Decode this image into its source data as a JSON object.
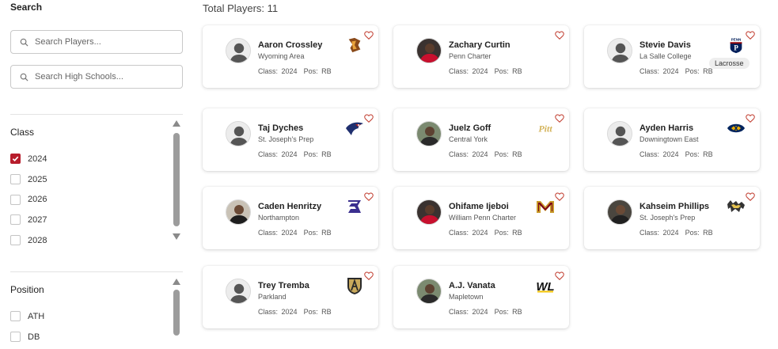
{
  "sidebar": {
    "search_heading": "Search",
    "player_search": {
      "placeholder": "Search Players..."
    },
    "school_search": {
      "placeholder": "Search High Schools..."
    },
    "class_filter": {
      "title": "Class",
      "options": [
        {
          "label": "2024",
          "checked": true
        },
        {
          "label": "2025",
          "checked": false
        },
        {
          "label": "2026",
          "checked": false
        },
        {
          "label": "2027",
          "checked": false
        },
        {
          "label": "2028",
          "checked": false
        }
      ]
    },
    "position_filter": {
      "title": "Position",
      "options": [
        {
          "label": "ATH",
          "checked": false
        },
        {
          "label": "DB",
          "checked": false
        }
      ]
    }
  },
  "main": {
    "total_players": "Total Players: 11",
    "class_prefix": "Class:",
    "pos_prefix": "Pos:",
    "players": [
      {
        "name": "Aaron Crossley",
        "school": "Wyoming Area",
        "class": "2024",
        "pos": "RB",
        "avatar": "silhouette",
        "logo": "lehigh-logo"
      },
      {
        "name": "Zachary Curtin",
        "school": "Penn Charter",
        "class": "2024",
        "pos": "RB",
        "avatar": "photo",
        "logo": ""
      },
      {
        "name": "Stevie Davis",
        "school": "La Salle College",
        "class": "2024",
        "pos": "RB",
        "avatar": "silhouette",
        "logo": "penn-logo",
        "sport": "Lacrosse",
        "logo_text": "PENN"
      },
      {
        "name": "Taj Dyches",
        "school": "St. Joseph's Prep",
        "class": "2024",
        "pos": "RB",
        "avatar": "silhouette",
        "logo": "hawk-logo"
      },
      {
        "name": "Juelz Goff",
        "school": "Central York",
        "class": "2024",
        "pos": "RB",
        "avatar": "photo",
        "logo": "pitt-logo",
        "logo_text": "Pitt"
      },
      {
        "name": "Ayden Harris",
        "school": "Downingtown East",
        "class": "2024",
        "pos": "RB",
        "avatar": "silhouette",
        "logo": "kent-state-logo"
      },
      {
        "name": "Caden Henritzy",
        "school": "Northampton",
        "class": "2024",
        "pos": "RB",
        "avatar": "photo",
        "logo": "s-logo"
      },
      {
        "name": "Ohifame Ijeboi",
        "school": "William Penn Charter",
        "class": "2024",
        "pos": "RB",
        "avatar": "photo",
        "logo": "minnesota-logo"
      },
      {
        "name": "Kahseim Phillips",
        "school": "St. Joseph's Prep",
        "class": "2024",
        "pos": "RB",
        "avatar": "photo",
        "logo": "wildcat-logo"
      },
      {
        "name": "Trey Tremba",
        "school": "Parkland",
        "class": "2024",
        "pos": "RB",
        "avatar": "silhouette",
        "logo": "army-shield-logo"
      },
      {
        "name": "A.J. Vanata",
        "school": "Mapletown",
        "class": "2024",
        "pos": "RB",
        "avatar": "photo",
        "logo": "wl-logo",
        "logo_text": "WL"
      }
    ]
  },
  "colors": {
    "accent_red": "#b71c2b",
    "heart": "#c0392b",
    "scrollbar": "#9c9c9c"
  }
}
